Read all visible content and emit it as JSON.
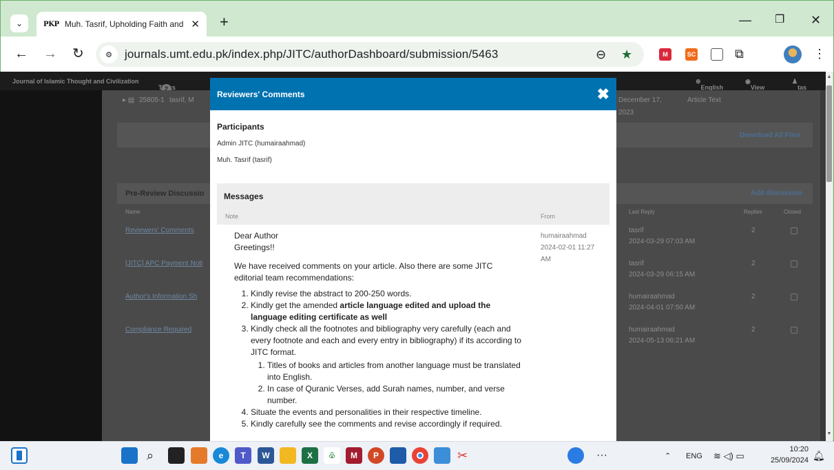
{
  "browser": {
    "tab_title": "Muh. Tasrif, Upholding Faith and Relig",
    "tab_favicon": "PKP",
    "url": "journals.umt.edu.pk/index.php/JITC/authorDashboard/submission/5463",
    "icons": [
      "tab-search-icon",
      "close-icon",
      "new-tab-icon",
      "minimize-icon",
      "restore-icon",
      "back-icon",
      "forward-icon",
      "reload-icon",
      "site-info-icon",
      "zoom-icon",
      "bookmark-star-icon",
      "extension-icon",
      "profile-avatar"
    ]
  },
  "page": {
    "journal_name": "Journal of Islamic Thought and Civilization",
    "tasks_label": "Tasks",
    "tasks_count": "2",
    "language": "English",
    "view_site": "View Site",
    "user": "tas",
    "file_id": "25805-1",
    "file_name": "tasrif, M",
    "file_date": "December 17,",
    "file_year": "2023",
    "file_type": "Article Text",
    "download_all": "Download All Files",
    "discussion_heading": "Pre-Review Discussio",
    "add_discussion": "Add discussion",
    "columns": {
      "name": "Name",
      "last_reply": "Last Reply",
      "replies": "Replies",
      "closed": "Closed"
    },
    "discussions": [
      {
        "name": "Reviewers' Comments",
        "last_user": "tasrif",
        "last_date": "2024-03-29 07:03 AM",
        "replies": "2"
      },
      {
        "name": "[JITC] APC Payment Noti",
        "last_user": "tasrif",
        "last_date": "2024-03-29 06:15 AM",
        "replies": "2"
      },
      {
        "name": "Author's Information Sh",
        "last_user": "humairaahmad",
        "last_date": "2024-04-01 07:50 AM",
        "replies": "2"
      },
      {
        "name": "Compliance Required",
        "last_user": "humairaahmad",
        "last_date": "2024-05-13 06:21 AM",
        "replies": "2"
      }
    ]
  },
  "modal": {
    "title": "Reviewers' Comments",
    "participants_heading": "Participants",
    "participants": [
      "Admin JITC (humairaahmad)",
      "Muh. Tasrif (tasrif)"
    ],
    "messages_heading": "Messages",
    "col_note": "Note",
    "col_from": "From",
    "message": {
      "salutation": "Dear Author",
      "greeting": "Greetings!!",
      "intro": "We have received comments on your article. Also there are some JITC editorial team recommendations:",
      "item1": "Kindly revise the abstract to 200-250 words.",
      "item2_prefix": "Kindly get the amended ",
      "item2_bold": "article language edited and upload the language editing certificate as well",
      "item3": "Kindly check all the footnotes and bibliography very carefully (each and every footnote and each and every entry in bibliography) if its according to JITC format.",
      "item3_sub1": "Titles of books and articles from another language must be translated into English.",
      "item3_sub2": "In case of Quranic Verses, add Surah names, number, and verse number.",
      "item4": "Situate the events and personalities in their respective timeline.",
      "item5": "Kindly carefully see the comments and revise accordingly if required.",
      "from_user": "humairaahmad",
      "from_date": "2024-02-01 11:27 AM"
    }
  },
  "taskbar": {
    "language": "ENG",
    "time": "10:20",
    "date": "25/09/2024",
    "more": "···"
  }
}
